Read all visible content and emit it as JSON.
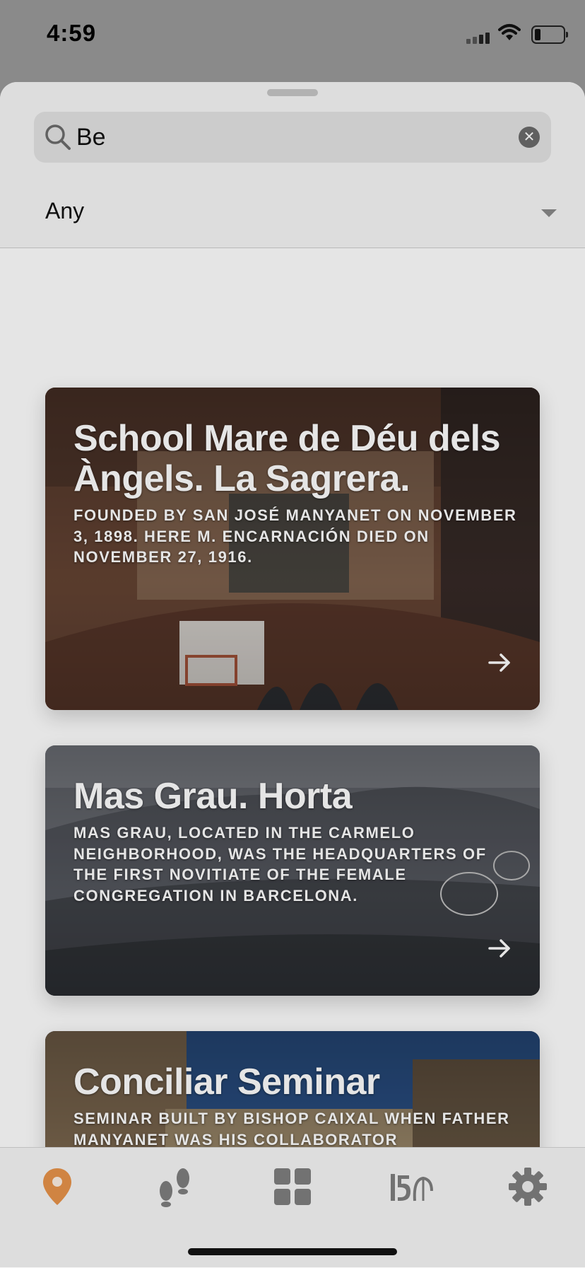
{
  "status_bar": {
    "time": "4:59"
  },
  "search": {
    "value": "Be"
  },
  "filter": {
    "selected": "Any"
  },
  "cards": [
    {
      "title": "School Mare de Déu dels Àngels. La Sagrera.",
      "description": "Founded by San José Manyanet on November 3, 1898. Here M. Encarnación died on November 27, 1916.",
      "colors": [
        "#6e4a38",
        "#8e6651",
        "#4f352a"
      ]
    },
    {
      "title": "Mas Grau. Horta",
      "description": "Mas Grau, located in the Carmelo neighborhood, was the headquarters of the first novitiate of the female congregation in Barcelona.",
      "colors": [
        "#7b7e86",
        "#5d6068",
        "#42454b"
      ]
    },
    {
      "title": "Conciliar Seminar",
      "description": "Seminar built by bishop Caixal when father Manyanet was his collaborator",
      "colors": [
        "#2f5a96",
        "#9b8769",
        "#6f5d48"
      ]
    }
  ],
  "tabs": [
    {
      "name": "map-pin-icon",
      "active": true
    },
    {
      "name": "footsteps-icon",
      "active": false
    },
    {
      "name": "grid-icon",
      "active": false
    },
    {
      "name": "anniversary-150-icon",
      "active": false
    },
    {
      "name": "gear-icon",
      "active": false
    }
  ],
  "colors": {
    "accent": "#e8934a",
    "inactive_icon": "#7f7f7f"
  }
}
